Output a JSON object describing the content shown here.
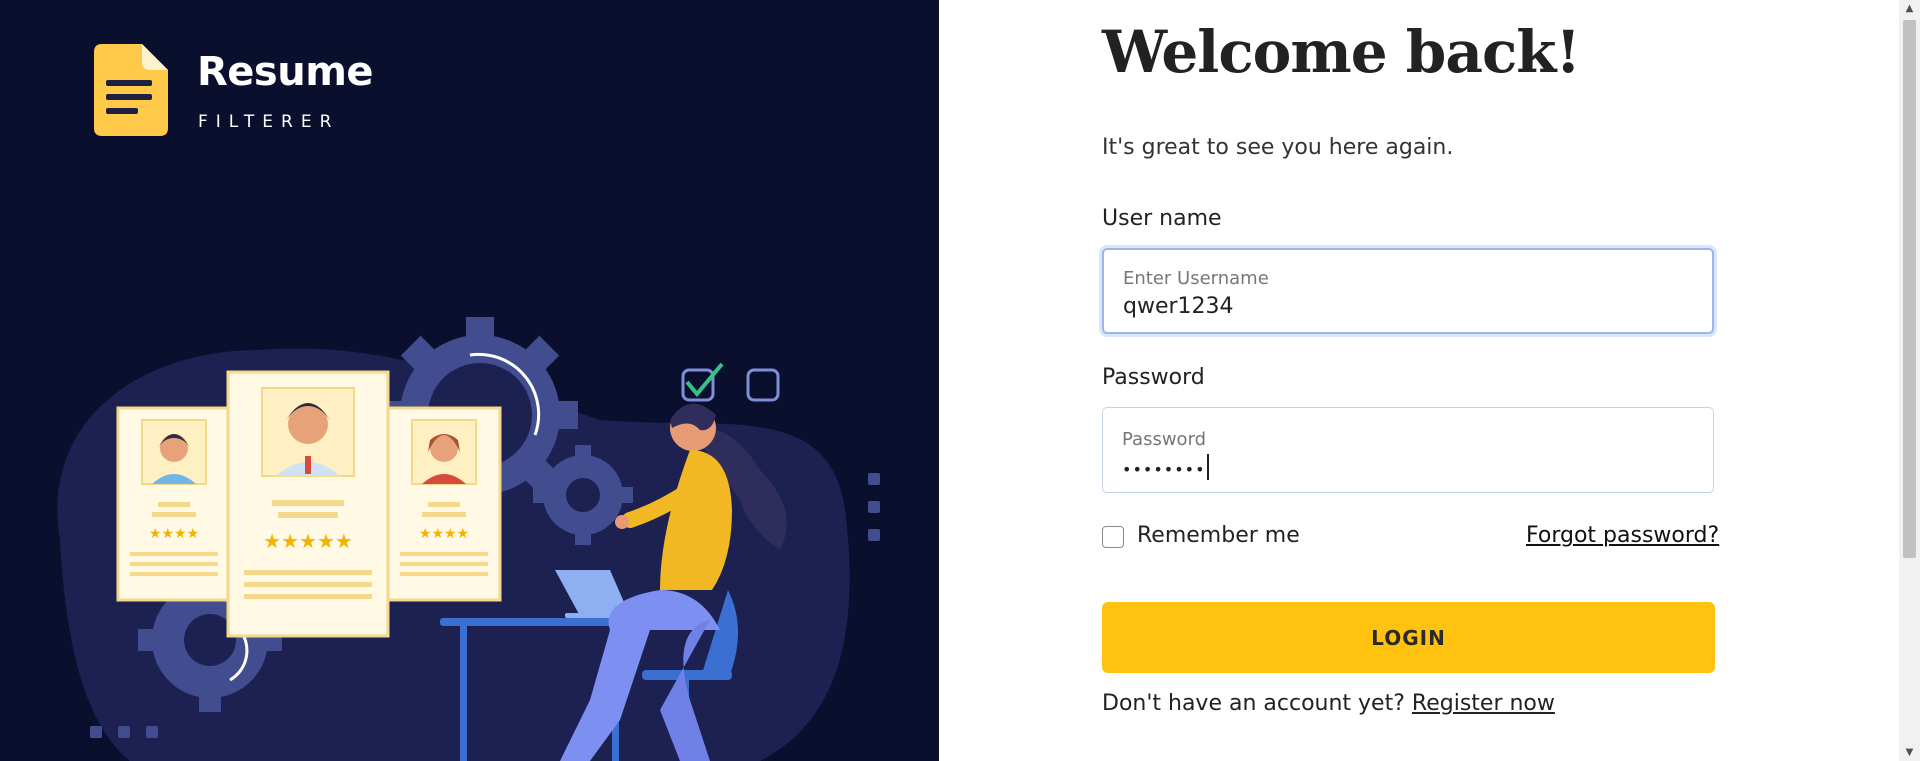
{
  "brand": {
    "title": "Resume",
    "subtitle": "FILTERER",
    "logo_icon": "document-icon",
    "accent_color": "#ffc20e",
    "panel_color": "#0b0f2e"
  },
  "login": {
    "title": "Welcome back!",
    "subtitle": "It's great to see you here again.",
    "username": {
      "label": "User name",
      "placeholder": "Enter Username",
      "value": "qwer1234"
    },
    "password": {
      "label": "Password",
      "placeholder": "Password",
      "value": "••••••••"
    },
    "remember_label": "Remember me",
    "remember_checked": false,
    "forgot_label": "Forgot password?",
    "login_button": "LOGIN",
    "no_account_text": "Don't have an account yet?",
    "register_link": "Register now"
  }
}
